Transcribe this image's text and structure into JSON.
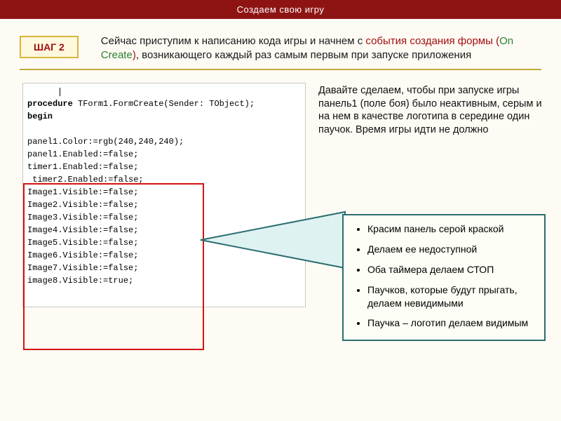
{
  "title": "Создаем свою игру",
  "step_label": "ШАГ 2",
  "intro": {
    "prefix": "Сейчас приступим к написанию кода игры и начнем с ",
    "event_text": "события создания формы ",
    "paren_open": "(",
    "on_create": "On Create",
    "paren_close": ")",
    "suffix": ", возникающего каждый раз самым первым при запуске приложения"
  },
  "description_paragraph": "Давайте сделаем, чтобы при запуске игры панель1 (поле боя) было неактивным, серым и на нем в качестве логотипа в середине один паучок. Время игры идти не должно",
  "code": {
    "header1_pre": "procedure",
    "header1_rest": " TForm1.FormCreate(Sender: TObject);",
    "header2": "begin",
    "lines": [
      "panel1.Color:=rgb(240,240,240);",
      "panel1.Enabled:=false;",
      "timer1.Enabled:=false;",
      " timer2.Enabled:=false;",
      "Image1.Visible:=false;",
      "Image2.Visible:=false;",
      "Image3.Visible:=false;",
      "Image4.Visible:=false;",
      "Image5.Visible:=false;",
      "Image6.Visible:=false;",
      "Image7.Visible:=false;",
      "image8.Visible:=true;"
    ]
  },
  "callout_items": [
    "Красим панель серой краской",
    "Делаем ее недоступной",
    "Оба таймера делаем СТОП",
    "Паучков, которые будут прыгать, делаем невидимыми",
    "Паучка – логотип делаем видимым"
  ]
}
